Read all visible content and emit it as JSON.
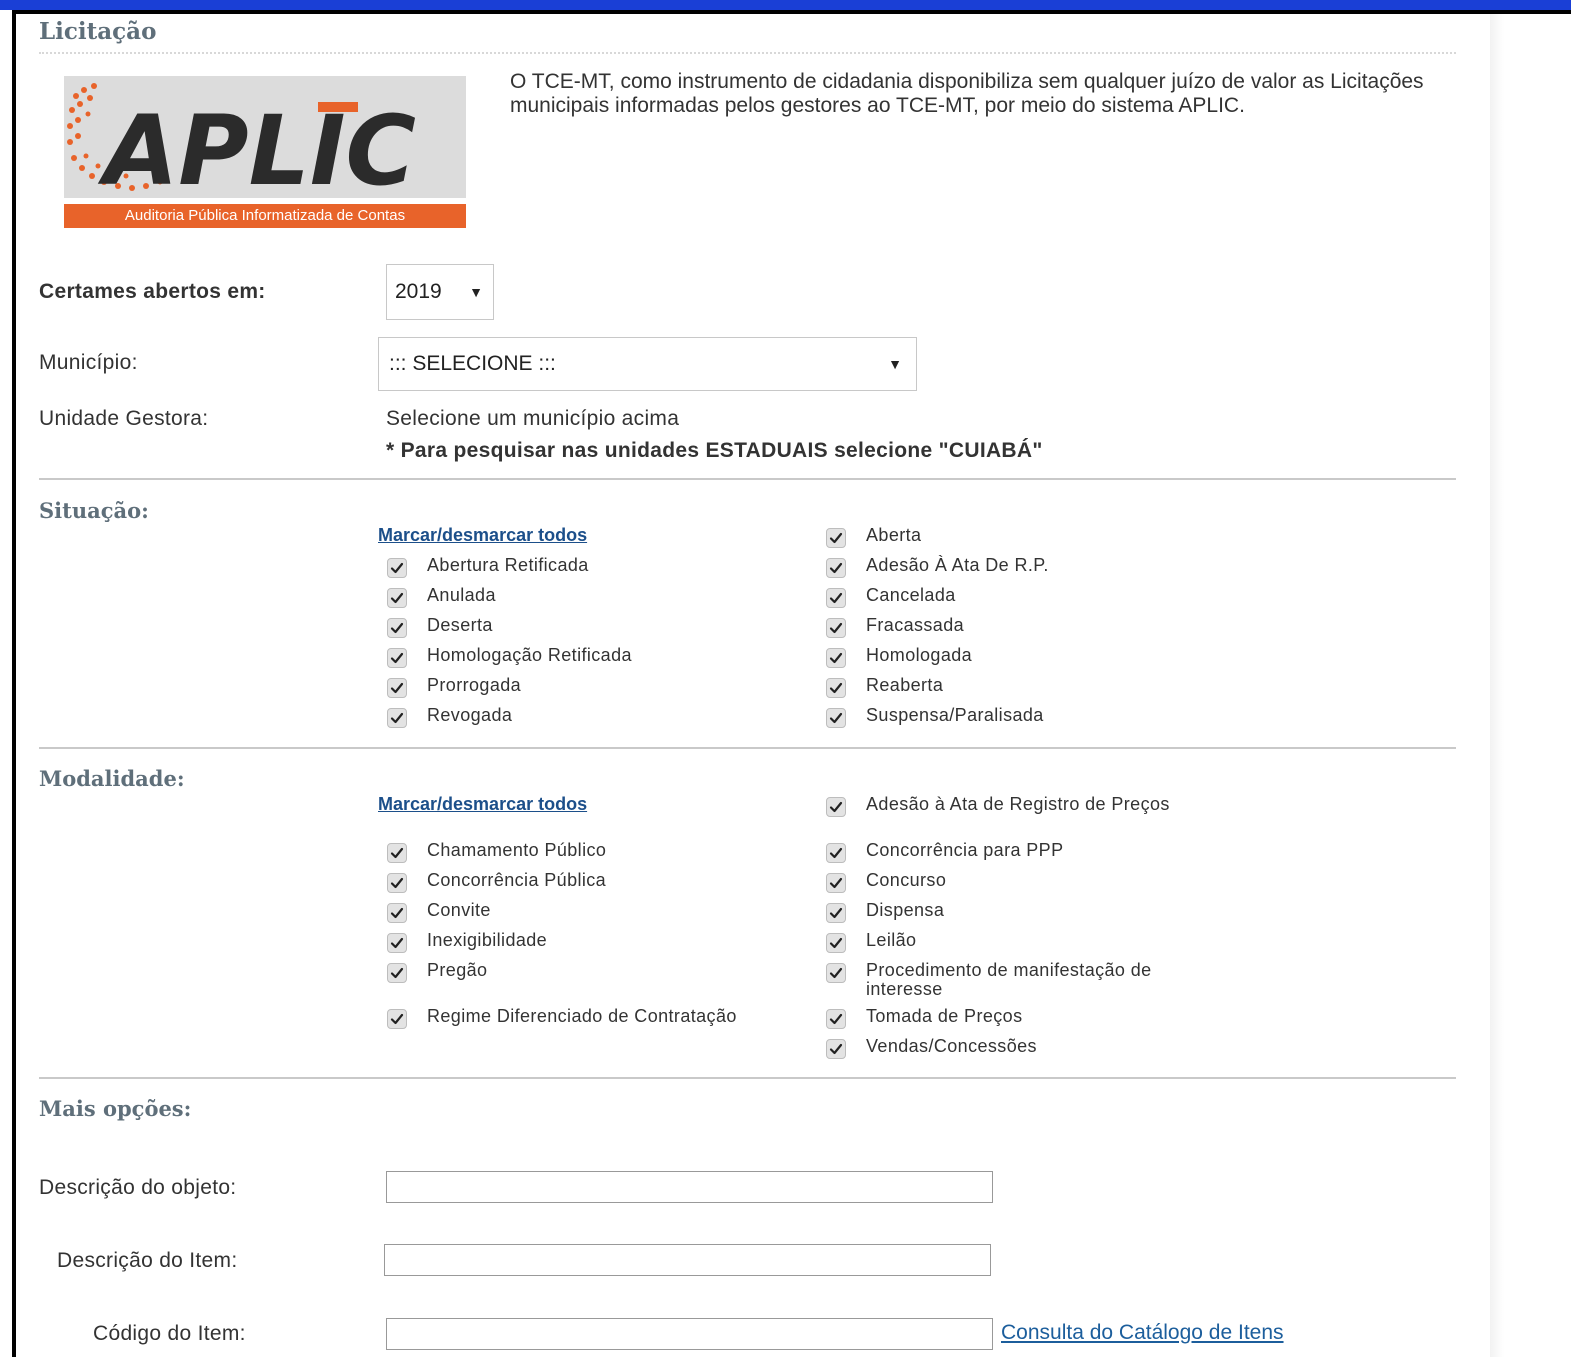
{
  "page": {
    "section_title": "Licitação",
    "intro_text": "O TCE-MT, como instrumento de cidadania disponibiliza sem qualquer juízo de valor as Licitações municipais informadas pelos gestores ao TCE-MT, por meio do sistema APLIC."
  },
  "logo": {
    "wordmark": "APLIC",
    "caption": "Auditoria Pública Informatizada de Contas",
    "accent_color": "#e8632a"
  },
  "filters": {
    "year_label": "Certames abertos em:",
    "year_value": "2019",
    "municipio_label": "Município:",
    "municipio_value": "::: SELECIONE :::",
    "unidade_label": "Unidade Gestora:",
    "unidade_value": "Selecione um município acima",
    "unidade_hint": "* Para pesquisar nas unidades ESTADUAIS selecione \"CUIABÁ\""
  },
  "situacao": {
    "title": "Situação:",
    "toggle_all": "Marcar/desmarcar todos",
    "left": [
      "Abertura Retificada",
      "Anulada",
      "Deserta",
      "Homologação Retificada",
      "Prorrogada",
      "Revogada"
    ],
    "right": [
      "Aberta",
      "Adesão À Ata De R.P.",
      "Cancelada",
      "Fracassada",
      "Homologada",
      "Reaberta",
      "Suspensa/Paralisada"
    ]
  },
  "modalidade": {
    "title": "Modalidade:",
    "toggle_all": "Marcar/desmarcar todos",
    "left": [
      "Chamamento Público",
      "Concorrência Pública",
      "Convite",
      "Inexigibilidade",
      "Pregão",
      "Regime Diferenciado de Contratação"
    ],
    "right": [
      "Adesão à Ata de Registro de Preços",
      "Concorrência para PPP",
      "Concurso",
      "Dispensa",
      "Leilão",
      "Procedimento de manifestação de interesse",
      "Tomada de Preços",
      "Vendas/Concessões"
    ]
  },
  "mais_opcoes": {
    "title": "Mais opções:",
    "descricao_objeto_label": "Descrição do objeto:",
    "descricao_objeto_value": "",
    "descricao_item_label": "Descrição do Item:",
    "descricao_item_value": "",
    "codigo_item_label": "Código do Item:",
    "codigo_item_value": "",
    "catalog_link": "Consulta do Catálogo de Itens"
  }
}
